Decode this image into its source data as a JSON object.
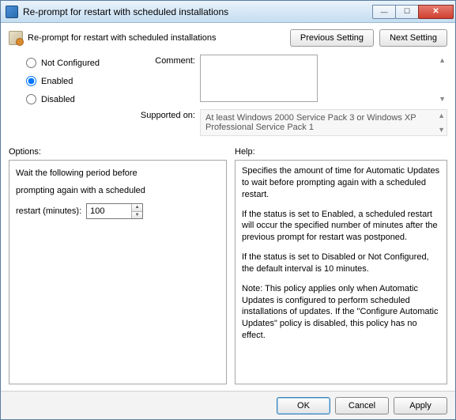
{
  "window": {
    "title": "Re-prompt for restart with scheduled installations"
  },
  "header": {
    "title": "Re-prompt for restart with scheduled installations",
    "prev": "Previous Setting",
    "next": "Next Setting"
  },
  "radios": {
    "not_configured": "Not Configured",
    "enabled": "Enabled",
    "disabled": "Disabled",
    "selected": "enabled"
  },
  "kv": {
    "comment_label": "Comment:",
    "comment_value": "",
    "supported_label": "Supported on:",
    "supported_value": "At least Windows 2000 Service Pack 3 or Windows XP Professional Service Pack 1"
  },
  "split": {
    "options_label": "Options:",
    "help_label": "Help:"
  },
  "options": {
    "line1": "Wait the following period before",
    "line2": "prompting again with a scheduled",
    "line3_label": "restart (minutes):",
    "value": "100"
  },
  "help": {
    "p1": "Specifies the amount of time for Automatic Updates to wait before prompting again with a scheduled restart.",
    "p2": "If the status is set to Enabled, a scheduled restart will occur the specified number of minutes after the previous prompt for restart was postponed.",
    "p3": "If the status is set to Disabled or Not Configured, the default interval is 10 minutes.",
    "p4": "Note: This policy applies only when Automatic Updates is configured to perform scheduled installations of updates. If the \"Configure Automatic Updates\" policy is disabled, this policy has no effect."
  },
  "footer": {
    "ok": "OK",
    "cancel": "Cancel",
    "apply": "Apply"
  }
}
